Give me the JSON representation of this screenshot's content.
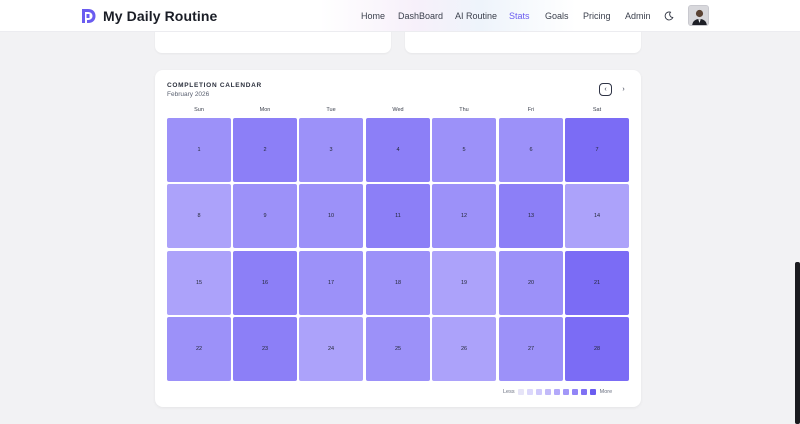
{
  "app": {
    "title": "My Daily Routine"
  },
  "nav": {
    "links": [
      {
        "label": "Home",
        "active": false
      },
      {
        "label": "DashBoard",
        "active": false
      },
      {
        "label": "AI Routine",
        "active": false
      },
      {
        "label": "Stats",
        "active": true
      },
      {
        "label": "Goals",
        "active": false
      },
      {
        "label": "Pricing",
        "active": false
      },
      {
        "label": "Admin",
        "active": false
      }
    ],
    "theme_icon": "moon-icon",
    "avatar_icon": "user-avatar"
  },
  "calendar": {
    "title": "COMPLETION CALENDAR",
    "month": "February 2026",
    "prev_icon": "chevron-left-icon",
    "next_icon": "chevron-right-icon",
    "weekdays": [
      "Sun",
      "Mon",
      "Tue",
      "Wed",
      "Thu",
      "Fri",
      "Sat"
    ],
    "days": [
      {
        "day": "1",
        "level": 5
      },
      {
        "day": "2",
        "level": 6
      },
      {
        "day": "3",
        "level": 5
      },
      {
        "day": "4",
        "level": 6
      },
      {
        "day": "5",
        "level": 5
      },
      {
        "day": "6",
        "level": 5
      },
      {
        "day": "7",
        "level": 7
      },
      {
        "day": "8",
        "level": 4
      },
      {
        "day": "9",
        "level": 5
      },
      {
        "day": "10",
        "level": 5
      },
      {
        "day": "11",
        "level": 6
      },
      {
        "day": "12",
        "level": 5
      },
      {
        "day": "13",
        "level": 6
      },
      {
        "day": "14",
        "level": 4
      },
      {
        "day": "15",
        "level": 4
      },
      {
        "day": "16",
        "level": 6
      },
      {
        "day": "17",
        "level": 5
      },
      {
        "day": "18",
        "level": 5
      },
      {
        "day": "19",
        "level": 4
      },
      {
        "day": "20",
        "level": 5
      },
      {
        "day": "21",
        "level": 7
      },
      {
        "day": "22",
        "level": 5
      },
      {
        "day": "23",
        "level": 6
      },
      {
        "day": "24",
        "level": 4
      },
      {
        "day": "25",
        "level": 5
      },
      {
        "day": "26",
        "level": 4
      },
      {
        "day": "27",
        "level": 5
      },
      {
        "day": "28",
        "level": 7
      }
    ],
    "legend": {
      "less": "Less",
      "more": "More",
      "colors": [
        "#e6e4f7",
        "#dcd8fb",
        "#cfc9fb",
        "#c2baf9",
        "#b3a9fa",
        "#a297f8",
        "#9285f7",
        "#7f71f4",
        "#6a5cf0"
      ]
    },
    "level_colors": [
      "#efedfb",
      "#e2defc",
      "#d2ccfb",
      "#c1b8fb",
      "#aca2fa",
      "#9c91f9",
      "#8c7ff7",
      "#7b6cf5"
    ]
  }
}
